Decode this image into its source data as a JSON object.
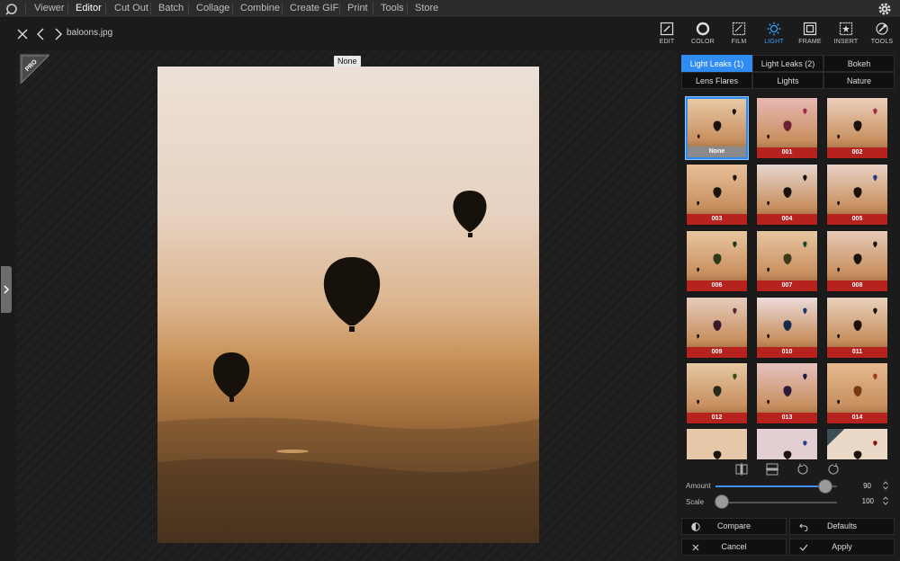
{
  "menubar": {
    "items": [
      "Viewer",
      "Editor",
      "Cut Out",
      "Batch",
      "Collage",
      "Combine",
      "Create GIF",
      "Print",
      "Tools",
      "Store"
    ],
    "active": "Editor"
  },
  "toolbar": {
    "filename": "baloons.jpg",
    "tabs": [
      "EDIT",
      "COLOR",
      "FILM",
      "LIGHT",
      "FRAME",
      "INSERT",
      "TOOLS"
    ],
    "active_tab": "LIGHT"
  },
  "canvas": {
    "pro_badge": "PRO",
    "filter_name": "None"
  },
  "panel": {
    "category_tabs": [
      "Light Leaks (1)",
      "Light Leaks (2)",
      "Bokeh",
      "Lens Flares",
      "Lights",
      "Nature"
    ],
    "active_category": "Light Leaks (1)",
    "thumbnails": [
      "None",
      "001",
      "002",
      "003",
      "004",
      "005",
      "006",
      "007",
      "008",
      "009",
      "010",
      "011",
      "012",
      "013",
      "014"
    ],
    "selected_thumbnail": "None",
    "amount": {
      "label": "Amount",
      "value": "90",
      "fraction": 0.9
    },
    "scale": {
      "label": "Scale",
      "value": "100",
      "fraction": 0.0
    },
    "buttons": {
      "compare": "Compare",
      "defaults": "Defaults",
      "cancel": "Cancel",
      "apply": "Apply"
    }
  },
  "colors": {
    "accent": "#2f8cf0",
    "thumb_label": "#b6231f"
  }
}
